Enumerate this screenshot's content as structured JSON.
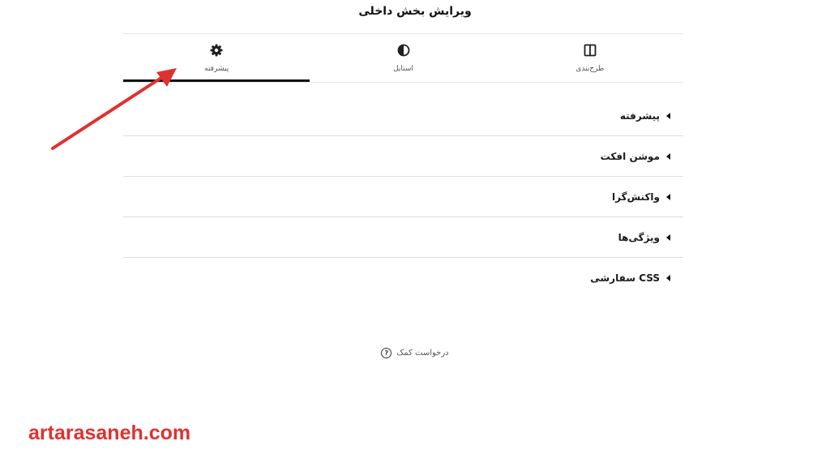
{
  "panel": {
    "title": "ویرایش بخش داخلی"
  },
  "tabs": [
    {
      "label": "طرح‌بندی",
      "icon": "layout-columns-icon",
      "active": false
    },
    {
      "label": "استایل",
      "icon": "contrast-circle-icon",
      "active": false
    },
    {
      "label": "پیشرفته",
      "icon": "gear-icon",
      "active": true
    }
  ],
  "sections": [
    {
      "label": "پیشرفته"
    },
    {
      "label": "موشن افکت"
    },
    {
      "label": "واکنش‌گرا"
    },
    {
      "label": "ویژگی‌ها"
    },
    {
      "label": "CSS سفارشی"
    }
  ],
  "help": {
    "label": "درخواست کمک",
    "icon_glyph": "?"
  },
  "watermark": {
    "text": "artarasaneh.com"
  },
  "colors": {
    "annotation_arrow": "#e0312f",
    "active_tab_indicator": "#111111"
  }
}
